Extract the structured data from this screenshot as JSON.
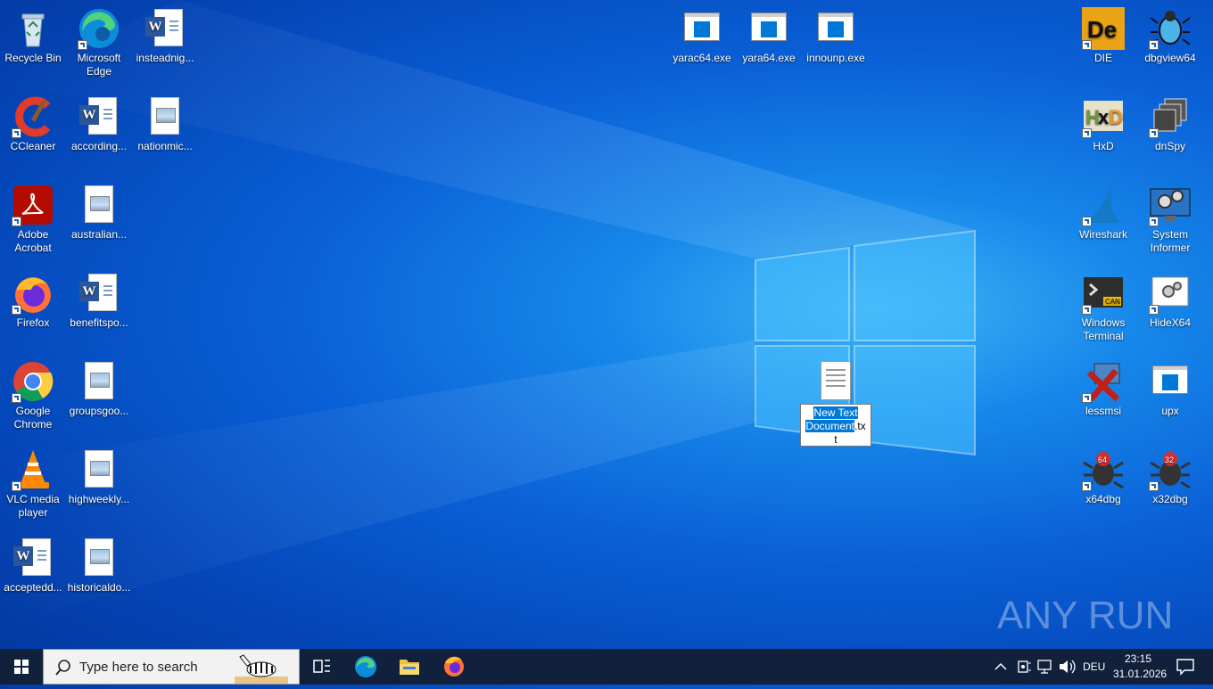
{
  "desktop": {
    "left_icons": [
      {
        "label": "Recycle Bin",
        "icon": "recycle-bin-icon"
      },
      {
        "label": "Microsoft Edge",
        "icon": "edge-icon"
      },
      {
        "label": "insteadnig...",
        "icon": "word-doc-icon"
      },
      {
        "label": "CCleaner",
        "icon": "ccleaner-icon"
      },
      {
        "label": "according...",
        "icon": "word-doc-icon"
      },
      {
        "label": "nationmic...",
        "icon": "image-file-icon"
      },
      {
        "label": "Adobe Acrobat",
        "icon": "acrobat-icon"
      },
      {
        "label": "australian...",
        "icon": "image-file-icon"
      },
      {
        "label": "Firefox",
        "icon": "firefox-icon"
      },
      {
        "label": "benefitspo...",
        "icon": "word-doc-icon"
      },
      {
        "label": "Google Chrome",
        "icon": "chrome-icon"
      },
      {
        "label": "groupsgoo...",
        "icon": "image-file-icon"
      },
      {
        "label": "VLC media player",
        "icon": "vlc-icon"
      },
      {
        "label": "highweekly...",
        "icon": "image-file-icon"
      },
      {
        "label": "acceptedd...",
        "icon": "word-doc-icon"
      },
      {
        "label": "historicaldo...",
        "icon": "image-file-icon"
      }
    ],
    "top_icons": [
      {
        "label": "yarac64.exe",
        "icon": "exe-icon"
      },
      {
        "label": "yara64.exe",
        "icon": "exe-icon"
      },
      {
        "label": "innounp.exe",
        "icon": "exe-icon"
      }
    ],
    "right_icons": [
      {
        "label": "DIE",
        "icon": "die-icon"
      },
      {
        "label": "dbgview64",
        "icon": "dbgview-icon"
      },
      {
        "label": "HxD",
        "icon": "hxd-icon"
      },
      {
        "label": "dnSpy",
        "icon": "dnspy-icon"
      },
      {
        "label": "Wireshark",
        "icon": "wireshark-icon"
      },
      {
        "label": "System Informer",
        "icon": "system-informer-icon"
      },
      {
        "label": "Windows Terminal",
        "icon": "terminal-icon"
      },
      {
        "label": "HideX64",
        "icon": "hidex-icon"
      },
      {
        "label": "lessmsi",
        "icon": "lessmsi-icon"
      },
      {
        "label": "upx",
        "icon": "exe-icon"
      },
      {
        "label": "x64dbg",
        "icon": "x64dbg-icon"
      },
      {
        "label": "x32dbg",
        "icon": "x32dbg-icon"
      }
    ],
    "rename": {
      "selected": "New Text Document",
      "rest_line2": ".tx",
      "rest_line3": "t"
    },
    "watermark": "ANY RUN"
  },
  "taskbar": {
    "search_placeholder": "Type here to search",
    "language": "DEU",
    "time": "23:15",
    "date": "31.01.2026"
  },
  "colors": {
    "accent": "#0078d7",
    "taskbar": "#11203b"
  }
}
